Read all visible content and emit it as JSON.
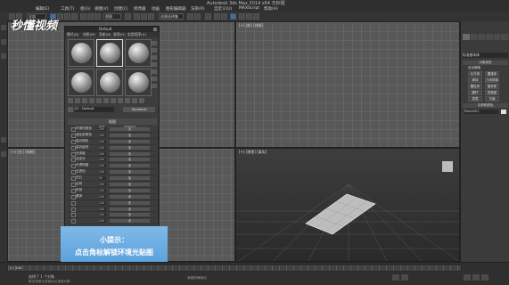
{
  "app": {
    "title": "Autodesk 3ds Max  2014 x64      无标题",
    "menu": [
      "编辑(E)",
      "工具(T)",
      "组(G)",
      "视图(V)",
      "创建(C)",
      "修改器",
      "动画",
      "图形编辑器",
      "渲染(R)",
      "自定义(U)",
      "MAXScript",
      "帮助(H)"
    ],
    "selection_set": "全部",
    "view_dropdown": "视图",
    "create_selection_set": "创建选择集"
  },
  "logo": {
    "text": "秒懂视频"
  },
  "viewports": {
    "top": "[+] [顶] [线框]",
    "front": "[+] [前] [线框]",
    "left": "[+] [左] [线框]",
    "perspective": "[+] [透视] [真实]"
  },
  "material_editor": {
    "title": "Default",
    "menu": [
      "模式(D)",
      "材质(M)",
      "导航(N)",
      "选项(O)",
      "实用程序(U)"
    ],
    "material_name": "01 - Default",
    "material_type": "Standard",
    "rollout_title": "贴图",
    "col_amount": "数量",
    "col_map": "贴图类型",
    "maps": [
      {
        "label": "环境光颜色",
        "amount": "100",
        "map": "无"
      },
      {
        "label": "漫反射颜色",
        "amount": "100",
        "map": "无"
      },
      {
        "label": "高光颜色",
        "amount": "100",
        "map": "无"
      },
      {
        "label": "高光级别",
        "amount": "100",
        "map": "无"
      },
      {
        "label": "光泽度",
        "amount": "100",
        "map": "无"
      },
      {
        "label": "自发光",
        "amount": "100",
        "map": "无"
      },
      {
        "label": "不透明度",
        "amount": "100",
        "map": "无"
      },
      {
        "label": "过滤色",
        "amount": "100",
        "map": "无"
      },
      {
        "label": "凹凸",
        "amount": "30",
        "map": "无"
      },
      {
        "label": "反射",
        "amount": "100",
        "map": "无"
      },
      {
        "label": "折射",
        "amount": "100",
        "map": "无"
      },
      {
        "label": "置换",
        "amount": "100",
        "map": "无"
      },
      {
        "label": "",
        "amount": "100",
        "map": "无"
      },
      {
        "label": "",
        "amount": "100",
        "map": "无"
      },
      {
        "label": "",
        "amount": "100",
        "map": "无"
      },
      {
        "label": "",
        "amount": "100",
        "map": "无"
      }
    ]
  },
  "command_panel": {
    "category": "标准基本体",
    "rollout_object_type": "对象类型",
    "autogrid": "自动栅格",
    "buttons": [
      "长方体",
      "圆锥体",
      "球体",
      "几何球体",
      "圆柱体",
      "管状体",
      "圆环",
      "四棱锥",
      "茶壶",
      "平面"
    ],
    "rollout_name_color": "名称和颜色",
    "object_name": "Plane001"
  },
  "status": {
    "frame": "0 / 100",
    "prompt": "选择了 1 个对象",
    "hint": "单击或单击并拖动以选择对象",
    "add_time_tag": "添加时间标记"
  },
  "banner": {
    "line1": "小提示：",
    "line2": "点击角标解锁环境光贴图"
  }
}
